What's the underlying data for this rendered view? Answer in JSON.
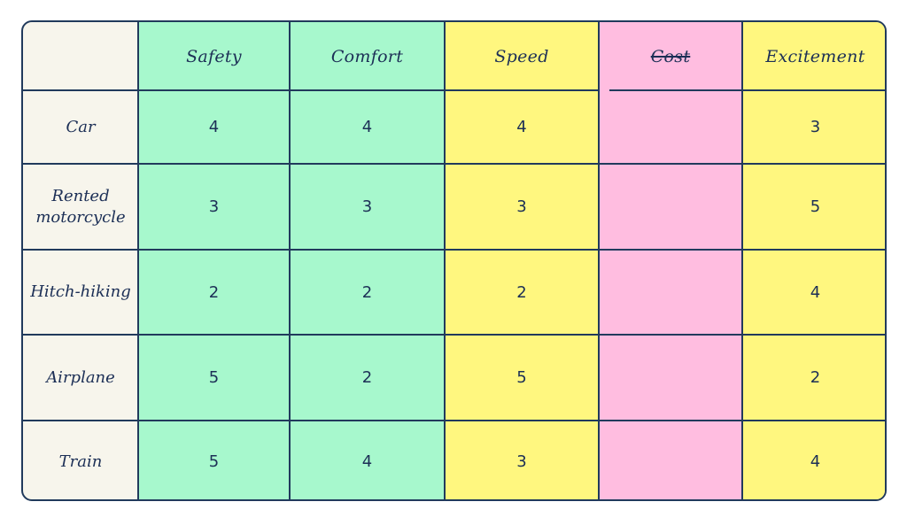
{
  "table": {
    "title": "",
    "corner_label": "",
    "columns": [
      {
        "key": "safety",
        "label": "Safety",
        "color": "#a7f8cd",
        "struck": false
      },
      {
        "key": "comfort",
        "label": "Comfort",
        "color": "#a7f8cd",
        "struck": false
      },
      {
        "key": "speed",
        "label": "Speed",
        "color": "#fff77f",
        "struck": false
      },
      {
        "key": "cost",
        "label": "Cost",
        "color": "#ffbde0",
        "struck": true
      },
      {
        "key": "excitement",
        "label": "Excitement",
        "color": "#fff77f",
        "struck": false
      }
    ],
    "row_label_color": "#f7f5ec",
    "line_color": "#213a5c",
    "text_color": "#1c2f56",
    "rows": [
      {
        "label": "Car",
        "values": [
          "4",
          "4",
          "4",
          "",
          "3"
        ]
      },
      {
        "label": "Rented motorcycle",
        "values": [
          "3",
          "3",
          "3",
          "",
          "5"
        ]
      },
      {
        "label": "Hitch-hiking",
        "values": [
          "2",
          "2",
          "2",
          "",
          "4"
        ]
      },
      {
        "label": "Airplane",
        "values": [
          "5",
          "2",
          "5",
          "",
          "2"
        ]
      },
      {
        "label": "Train",
        "values": [
          "5",
          "4",
          "3",
          "",
          "4"
        ]
      }
    ]
  }
}
